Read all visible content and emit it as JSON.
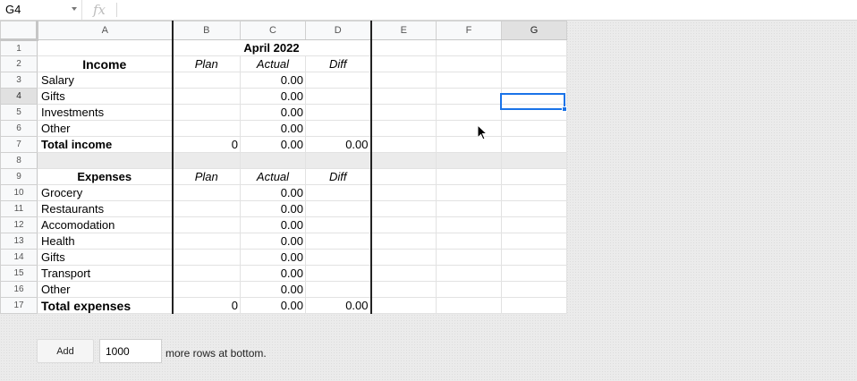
{
  "formula_bar": {
    "cell_ref": "G4",
    "fx_label": "fx",
    "formula": ""
  },
  "columns": [
    "A",
    "B",
    "C",
    "D",
    "E",
    "F",
    "G"
  ],
  "rows": {
    "r1": {
      "num": "1",
      "a": "",
      "b": "",
      "c": "April 2022",
      "d": ""
    },
    "r2": {
      "num": "2",
      "a": "Income",
      "b": "Plan",
      "c": "Actual",
      "d": "Diff"
    },
    "r3": {
      "num": "3",
      "a": "Salary",
      "b": "",
      "c": "0.00",
      "d": ""
    },
    "r4": {
      "num": "4",
      "a": "Gifts",
      "b": "",
      "c": "0.00",
      "d": ""
    },
    "r5": {
      "num": "5",
      "a": "Investments",
      "b": "",
      "c": "0.00",
      "d": ""
    },
    "r6": {
      "num": "6",
      "a": "Other",
      "b": "",
      "c": "0.00",
      "d": ""
    },
    "r7": {
      "num": "7",
      "a": "Total income",
      "b": "0",
      "c": "0.00",
      "d": "0.00"
    },
    "r8": {
      "num": "8",
      "a": "",
      "b": "",
      "c": "",
      "d": ""
    },
    "r9": {
      "num": "9",
      "a": "Expenses",
      "b": "Plan",
      "c": "Actual",
      "d": "Diff"
    },
    "r10": {
      "num": "10",
      "a": "Grocery",
      "b": "",
      "c": "0.00",
      "d": ""
    },
    "r11": {
      "num": "11",
      "a": "Restaurants",
      "b": "",
      "c": "0.00",
      "d": ""
    },
    "r12": {
      "num": "12",
      "a": "Accomodation",
      "b": "",
      "c": "0.00",
      "d": ""
    },
    "r13": {
      "num": "13",
      "a": "Health",
      "b": "",
      "c": "0.00",
      "d": ""
    },
    "r14": {
      "num": "14",
      "a": "Gifts",
      "b": "",
      "c": "0.00",
      "d": ""
    },
    "r15": {
      "num": "15",
      "a": "Transport",
      "b": "",
      "c": "0.00",
      "d": ""
    },
    "r16": {
      "num": "16",
      "a": "Other",
      "b": "",
      "c": "0.00",
      "d": ""
    },
    "r17": {
      "num": "17",
      "a": "Total expenses",
      "b": "0",
      "c": "0.00",
      "d": "0.00"
    }
  },
  "selected": {
    "cell": "G4",
    "column": "G",
    "row": "4"
  },
  "add_rows": {
    "button_label": "Add",
    "count": "1000",
    "suffix_label": "more rows at bottom."
  },
  "colors": {
    "selection": "#1a73e8",
    "header_bg": "#f8f9fa",
    "separator_row": "#ebebeb"
  },
  "icons": {
    "cursor": "mouse-pointer-icon",
    "caret": "chevron-down-icon"
  }
}
